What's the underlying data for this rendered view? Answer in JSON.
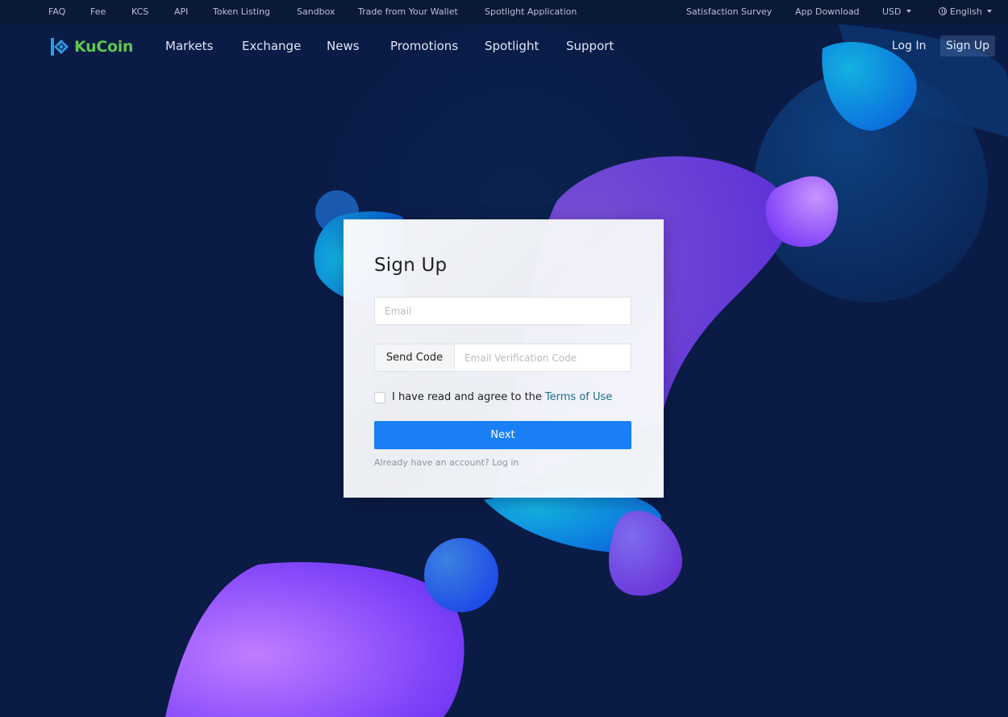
{
  "topbar": {
    "left_items": [
      "FAQ",
      "Fee",
      "KCS",
      "API",
      "Token Listing",
      "Sandbox",
      "Trade from Your Wallet",
      "Spotlight Application"
    ],
    "right_items": {
      "survey": "Satisfaction Survey",
      "app_download": "App Download",
      "currency": "USD",
      "language": "English"
    }
  },
  "nav": {
    "brand": "KuCoin",
    "links": [
      "Markets",
      "Exchange",
      "News",
      "Promotions",
      "Spotlight",
      "Support"
    ],
    "login": "Log In",
    "signup": "Sign Up"
  },
  "form": {
    "title": "Sign Up",
    "email_placeholder": "Email",
    "email_value": "",
    "send_code_label": "Send Code",
    "code_placeholder": "Email Verification Code",
    "code_value": "",
    "agree_text": "I have read and agree to the",
    "terms_link": "Terms of Use",
    "agree_checked": false,
    "next_label": "Next",
    "already_text": "Already have an account? Log in"
  },
  "colors": {
    "background": "#0a1b45",
    "brand_green": "#5ec84e",
    "brand_blue": "#2d9be8",
    "primary_button": "#1a7ff5",
    "terms_link": "#1d6f8c"
  }
}
